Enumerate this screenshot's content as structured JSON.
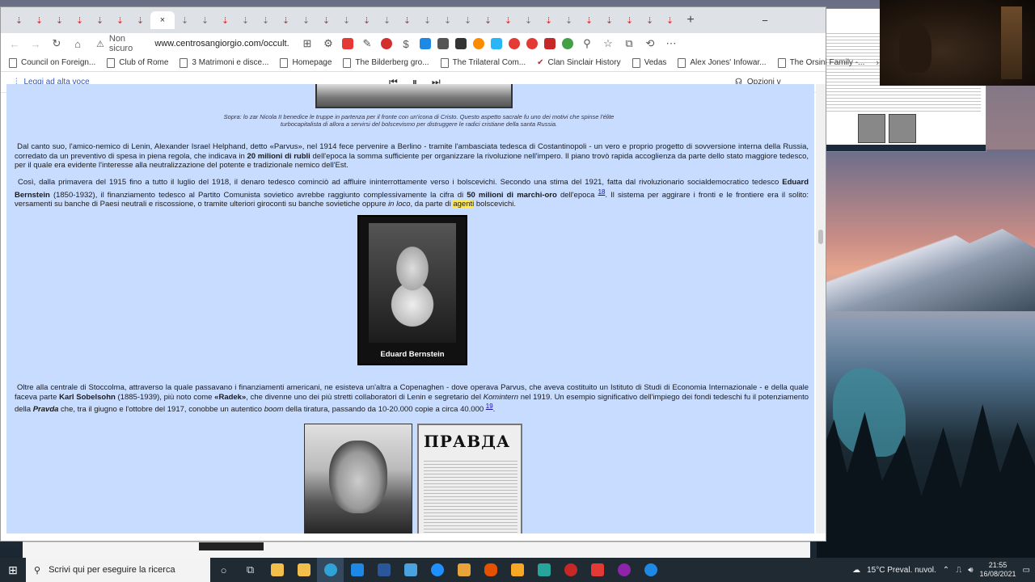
{
  "browser": {
    "tabs": [
      "⇣",
      "⇣",
      "⇣",
      "⇣",
      "⇣",
      "⇣",
      "⇣",
      "⇣",
      "⇣",
      "⇣",
      "⇣",
      "⇣",
      "⇣",
      "⇣",
      "⇣",
      "⇣",
      "⇣",
      "⇣",
      "⇣",
      "⇣",
      "⇣",
      "⇣",
      "⇣",
      "⇣",
      "⇣",
      "⇣",
      "⇣",
      "⇣",
      "⇣",
      "⇣",
      "⇣",
      "⇣",
      "⇣",
      "⇣",
      "⇣",
      "⇣"
    ],
    "active_tab_close": "×",
    "new_tab": "+",
    "minimize": "−",
    "address": {
      "security": "Non sicuro",
      "url": "www.centrosangiorgio.com/occult..."
    },
    "bookmarks": [
      "Council on Foreign...",
      "Club of Rome",
      "3 Matrimoni e disce...",
      "Homepage",
      "The Bilderberg gro...",
      "The Trilateral Com...",
      "Clan Sinclair History",
      "Vedas",
      "Alex Jones' Infowar...",
      "The Orsini Family -..."
    ],
    "reader": {
      "read_aloud": "Leggi ad alta voce",
      "options": "Opzioni v"
    }
  },
  "article": {
    "caption_line1": "Sopra: lo zar Nicola II benedice le truppe in partenza per il fronte con un'icona di Cristo. Questo aspetto sacrale fu uno dei motivi che spinse l'élite",
    "caption_line2": "turbocapitalista di allora a servirsi del bolscevismo per distruggere le radici cristiane della santa Russia.",
    "p1": "Dal canto suo, l'amico-nemico di Lenin, Alexander Israel Helphand, detto «Parvus», nel 1914 fece pervenire a Berlino - tramite l'ambasciata tedesca di Costantinopoli - un vero e proprio progetto di sovversione interna della Russia, corredato da un preventivo di spesa in piena regola, che indicava in",
    "p1_bold": "20 milioni di rubli",
    "p1_tail": "dell'epoca la somma sufficiente per organizzare la rivoluzione nell'impero. Il piano trovò rapida accoglienza da parte dello stato maggiore tedesco, per il quale era evidente l'interesse alla neutralizzazione del potente e tradizionale nemico dell'Est.",
    "p2_a": "Così, dalla primavera del 1915 fino a tutto il luglio del 1918, il denaro tedesco cominciò ad affluire ininterrottamente verso i bolscevichi. Secondo una stima del 1921, fatta dal rivoluzionario socialdemocratico tedesco",
    "p2_name": "Eduard Bernstein",
    "p2_b": "(1850-1932), il finanziamento tedesco al Partito Comunista sovietico avrebbe raggiunto complessivamente la cifra di",
    "p2_bold": "50 milioni di marchi-oro",
    "p2_c": "dell'epoca",
    "p2_ref": "18",
    "p2_d": ". Il sistema per aggirare i fronti e le frontiere era il solito: versamenti su banche di Paesi neutrali e riscossione, o tramite ulteriori giroconti su banche sovietiche oppure",
    "p2_italic": "in loco",
    "p2_e": ", da parte di",
    "p2_highlight": "agenti",
    "p2_f": "bolscevichi.",
    "portrait_name": "Eduard Bernstein",
    "p3_a": "Oltre alla centrale di Stoccolma, attraverso la quale passavano i finanziamenti americani, ne esisteva un'altra a Copenaghen - dove operava Parvus, che aveva costituito un Istituto di Studi di Economia Internazionale - e della quale faceva parte",
    "p3_name": "Karl Sobelsohn",
    "p3_b": "(1885-1939), più noto come",
    "p3_alias": "«Radek»",
    "p3_c": ", che divenne uno dei più stretti collaboratori di Lenin e segretario del",
    "p3_komintern": "Komintern",
    "p3_d": "nel 1919. Un esempio significativo dell'impiego dei fondi tedeschi fu il potenziamento della",
    "p3_pravda": "Pravda",
    "p3_e": "che, tra il giugno e l'ottobre del 1917, conobbe un autentico",
    "p3_boom": "boom",
    "p3_f": "della tiratura, passando da 10-20.000 copie a circa 40.000",
    "p3_ref": "19",
    "p3_g": ".",
    "newspaper_masthead": "ПРАВДА"
  },
  "taskbar": {
    "search_placeholder": "Scrivi qui per eseguire la ricerca",
    "weather": "15°C Preval. nuvol.",
    "time": "21:55",
    "date": "16/08/2021"
  },
  "colors": {
    "page_bg": "#c8dcff",
    "highlight": "#ffe94a",
    "taskbar": "#1f2a33"
  }
}
